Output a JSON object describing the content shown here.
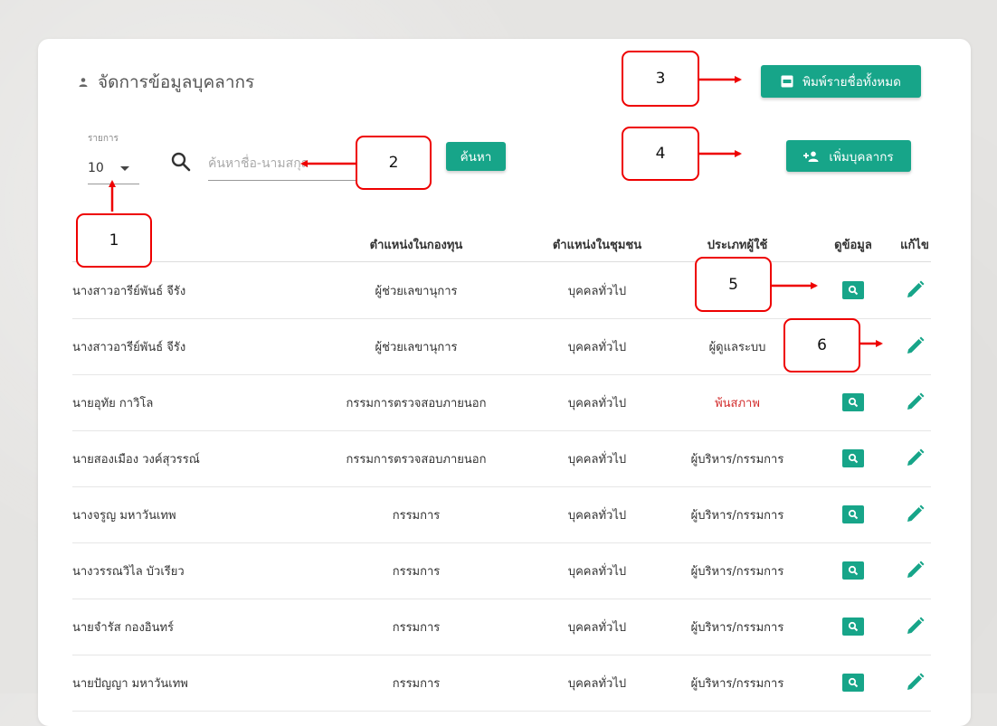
{
  "page": {
    "title": "จัดการข้อมูลบุคลากร",
    "print_button": "พิมพ์รายชื่อทั้งหมด",
    "add_button": "เพิ่มบุคลากร",
    "rows_label": "รายการ",
    "rows_value": "10",
    "search_placeholder": "ค้นหาชื่อ-นามสกุล",
    "search_button": "ค้นหา"
  },
  "table": {
    "headers": [
      "",
      "ตำแหน่งในกองทุน",
      "ตำแหน่งในชุมชน",
      "ประเภทผู้ใช้",
      "ดูข้อมูล",
      "แก้ไข"
    ],
    "rows": [
      {
        "name": "นางสาวอารีย์พันธ์ จีรัง",
        "position": "ผู้ช่วยเลขานุการ",
        "community": "บุคคลทั่วไป",
        "type": ""
      },
      {
        "name": "นางสาวอารีย์พันธ์ จีรัง",
        "position": "ผู้ช่วยเลขานุการ",
        "community": "บุคคลทั่วไป",
        "type": "ผู้ดูแลระบบ"
      },
      {
        "name": "นายอุทัย กาวิโล",
        "position": "กรรมการตรวจสอบภายนอก",
        "community": "บุคคลทั่วไป",
        "type": "พ้นสภาพ"
      },
      {
        "name": "นายสองเมือง วงค์สุวรรณ์",
        "position": "กรรมการตรวจสอบภายนอก",
        "community": "บุคคลทั่วไป",
        "type": "ผู้บริหาร/กรรมการ"
      },
      {
        "name": "นางจรูญ มหาวันเทพ",
        "position": "กรรมการ",
        "community": "บุคคลทั่วไป",
        "type": "ผู้บริหาร/กรรมการ"
      },
      {
        "name": "นางวรรณวิไล บัวเรียว",
        "position": "กรรมการ",
        "community": "บุคคลทั่วไป",
        "type": "ผู้บริหาร/กรรมการ"
      },
      {
        "name": "นายจำรัส กองอินทร์",
        "position": "กรรมการ",
        "community": "บุคคลทั่วไป",
        "type": "ผู้บริหาร/กรรมการ"
      },
      {
        "name": "นายปัญญา มหาวันเทพ",
        "position": "กรรมการ",
        "community": "บุคคลทั่วไป",
        "type": "ผู้บริหาร/กรรมการ"
      }
    ]
  },
  "annotations": [
    {
      "label": "1"
    },
    {
      "label": "2"
    },
    {
      "label": "3"
    },
    {
      "label": "4"
    },
    {
      "label": "5"
    },
    {
      "label": "6"
    }
  ],
  "colors": {
    "accent": "#17a589",
    "annotation": "#e00000",
    "inactive": "#d32f2f"
  },
  "icons": [
    "person-icon",
    "pdf-icon",
    "add-person-icon",
    "search-icon",
    "view-icon",
    "edit-icon"
  ]
}
